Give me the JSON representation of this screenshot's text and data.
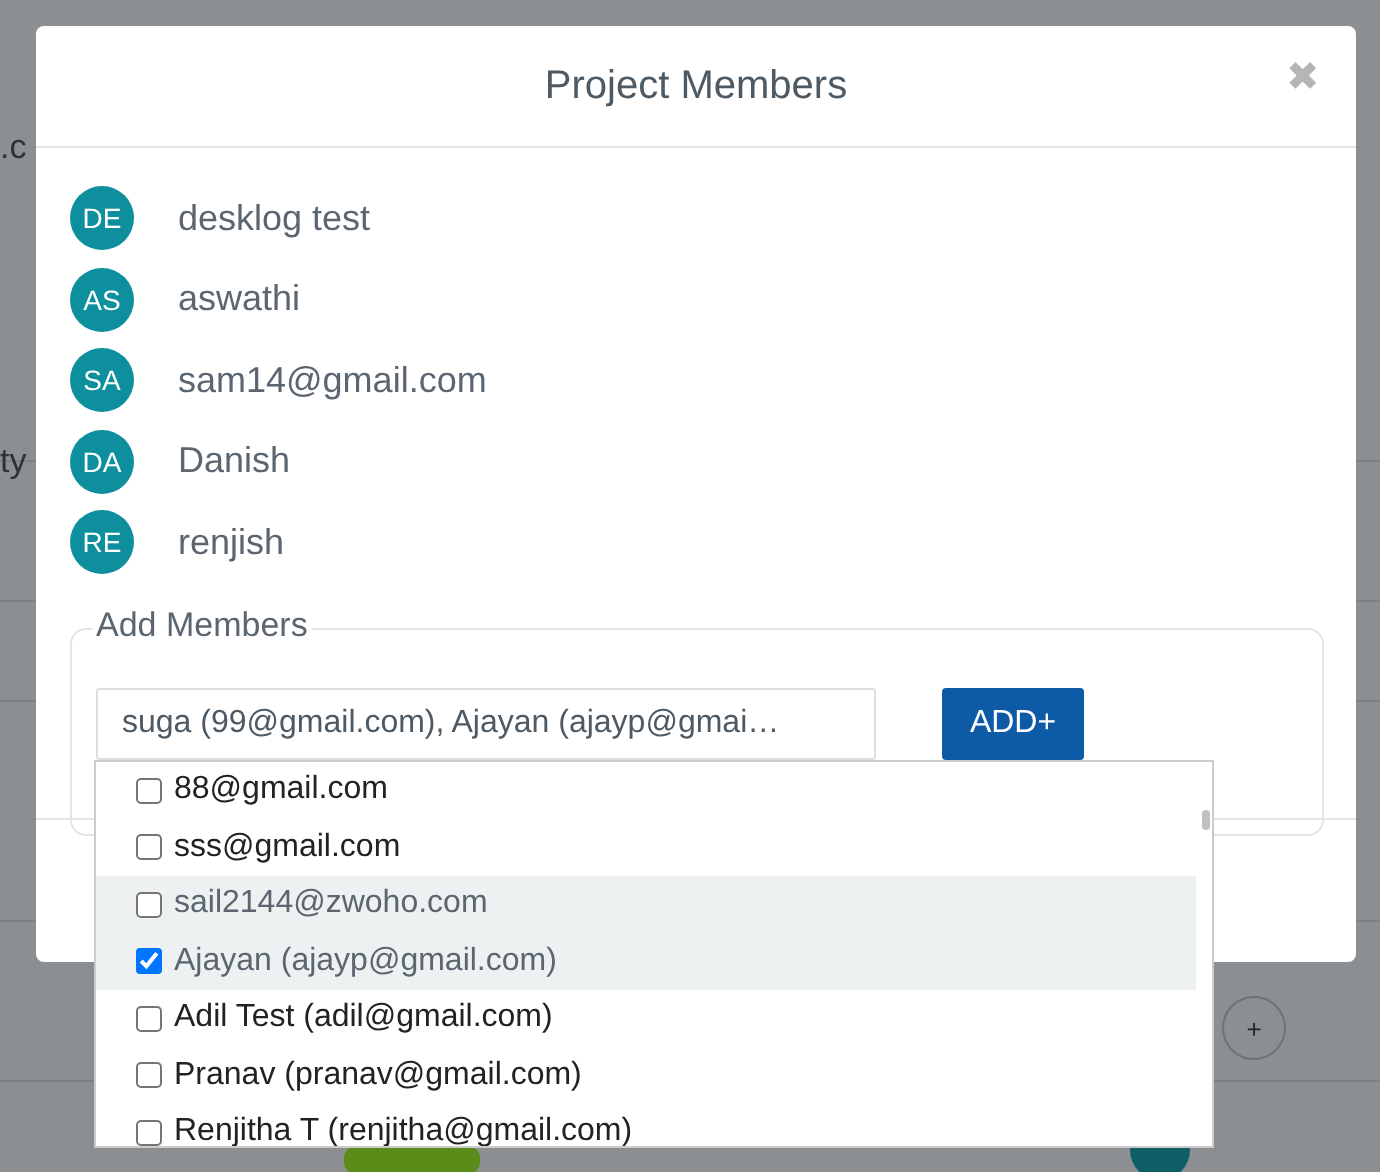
{
  "background": {
    "fragments": [
      ".c",
      "ty"
    ],
    "add_button": "+"
  },
  "dialog": {
    "title": "Project Members",
    "close": "✖",
    "members": [
      {
        "initials": "DE",
        "name": "desklog test"
      },
      {
        "initials": "AS",
        "name": "aswathi"
      },
      {
        "initials": "SA",
        "name": "sam14@gmail.com"
      },
      {
        "initials": "DA",
        "name": "Danish"
      },
      {
        "initials": "RE",
        "name": "renjish"
      }
    ],
    "add_members": {
      "legend": "Add Members",
      "value": "suga (99@gmail.com), Ajayan (ajayp@gmai…",
      "button": "ADD+",
      "options": [
        {
          "label": "88@gmail.com",
          "checked": false,
          "highlighted": false
        },
        {
          "label": "sss@gmail.com",
          "checked": false,
          "highlighted": false
        },
        {
          "label": "sail2144@zwoho.com",
          "checked": false,
          "highlighted": true
        },
        {
          "label": "Ajayan (ajayp@gmail.com)",
          "checked": true,
          "highlighted": true
        },
        {
          "label": "Adil Test (adil@gmail.com)",
          "checked": false,
          "highlighted": false
        },
        {
          "label": "Pranav (pranav@gmail.com)",
          "checked": false,
          "highlighted": false
        },
        {
          "label": "Renjitha T (renjitha@gmail.com)",
          "checked": false,
          "highlighted": false
        }
      ]
    }
  }
}
